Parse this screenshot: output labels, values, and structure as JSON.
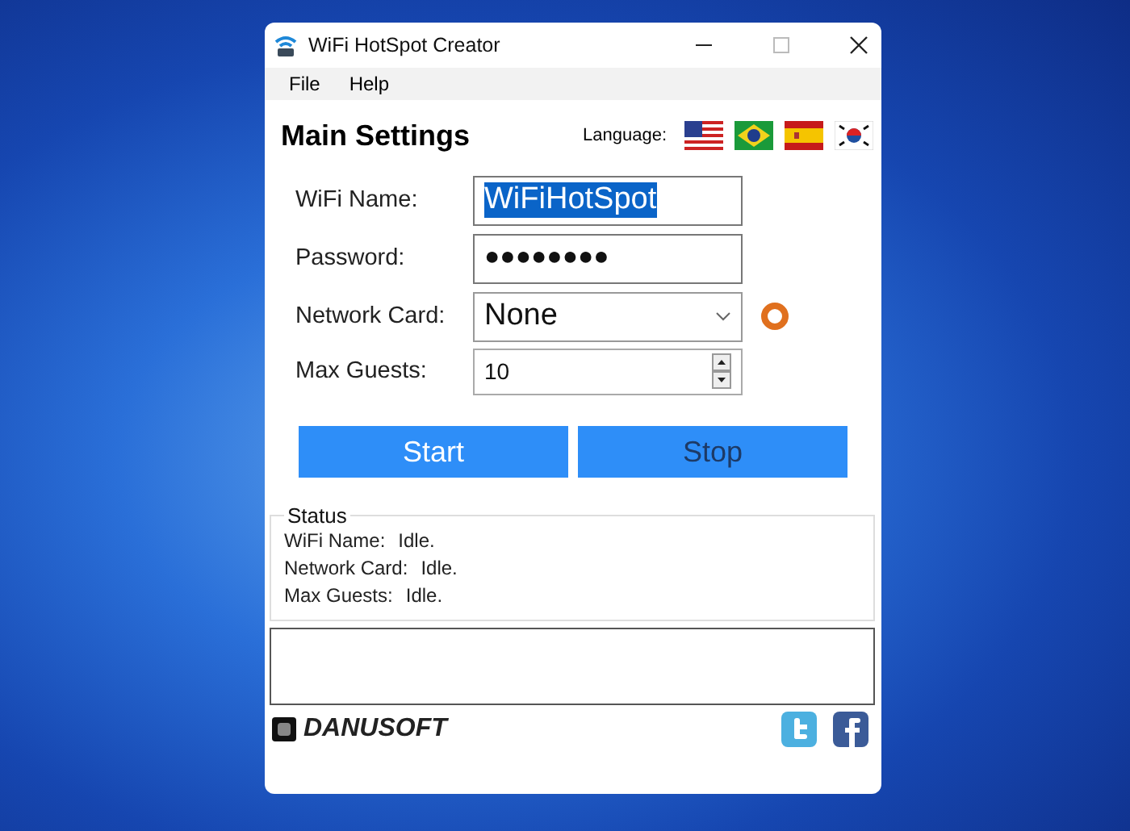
{
  "window": {
    "title": "WiFi HotSpot Creator"
  },
  "menu": [
    "File",
    "Help"
  ],
  "heading": "Main Settings",
  "language_label": "Language:",
  "form": [
    {
      "kind": "text",
      "label": "WiFi Name:",
      "value": "WiFiHotSpot",
      "text_selected": true
    },
    {
      "kind": "password",
      "label": "Password:",
      "value": "●●●●●●●●"
    },
    {
      "kind": "dropdown",
      "label": "Network Card:",
      "value": "None"
    },
    {
      "kind": "spinner",
      "label": "Max Guests:",
      "value": "10"
    }
  ],
  "buttons": [
    {
      "label": "Start",
      "disabled": false
    },
    {
      "label": "Stop",
      "disabled": true
    }
  ],
  "status": {
    "title": "Status",
    "rows": [
      {
        "label": "WiFi Name:",
        "value": "Idle."
      },
      {
        "label": "Network Card:",
        "value": "Idle."
      },
      {
        "label": "Max Guests:",
        "value": "Idle."
      }
    ]
  },
  "footer": {
    "logo": "DANUSOFT"
  }
}
